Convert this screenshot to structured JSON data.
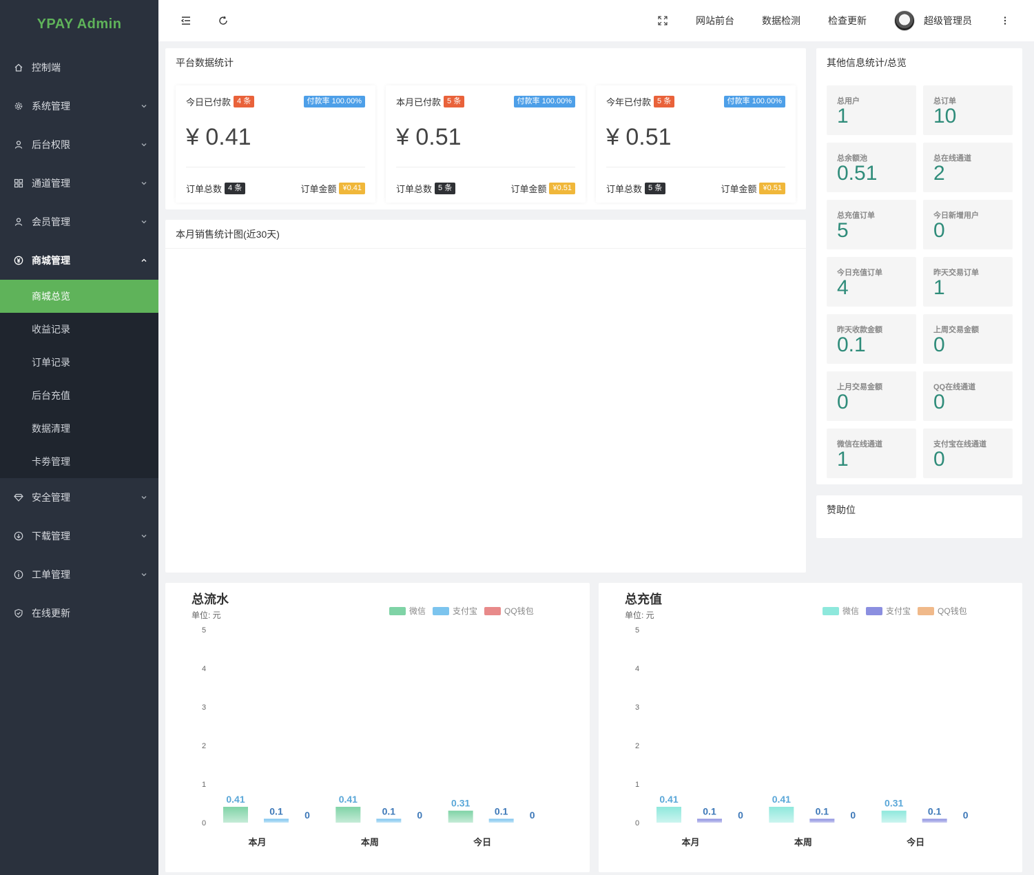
{
  "app": {
    "logo": "YPAY Admin"
  },
  "sidebar": {
    "items": [
      {
        "label": "控制端",
        "icon": "home-icon",
        "expandable": false
      },
      {
        "label": "系统管理",
        "icon": "gear-icon",
        "expandable": true
      },
      {
        "label": "后台权限",
        "icon": "user-icon",
        "expandable": true
      },
      {
        "label": "通道管理",
        "icon": "grid-icon",
        "expandable": true
      },
      {
        "label": "会员管理",
        "icon": "user-icon",
        "expandable": true
      },
      {
        "label": "商城管理",
        "icon": "yen-icon",
        "expandable": true,
        "open": true
      },
      {
        "label": "安全管理",
        "icon": "diamond-icon",
        "expandable": true
      },
      {
        "label": "下载管理",
        "icon": "download-icon",
        "expandable": true
      },
      {
        "label": "工单管理",
        "icon": "info-icon",
        "expandable": true
      },
      {
        "label": "在线更新",
        "icon": "shield-check-icon",
        "expandable": false
      }
    ],
    "submenu": [
      "商城总览",
      "收益记录",
      "订单记录",
      "后台充值",
      "数据清理",
      "卡劵管理"
    ],
    "active_sub": "商城总览"
  },
  "header": {
    "links": [
      "网站前台",
      "数据检测",
      "检查更新"
    ],
    "user": "超级管理员"
  },
  "platform_stats": {
    "title": "平台数据统计",
    "cards": [
      {
        "label": "今日已付款",
        "count": "4 条",
        "rate": "付款率 100.00%",
        "amount": "¥ 0.41",
        "total_label": "订单总数",
        "total": "4 条",
        "money_label": "订单金额",
        "money": "¥0.41"
      },
      {
        "label": "本月已付款",
        "count": "5 条",
        "rate": "付款率 100.00%",
        "amount": "¥ 0.51",
        "total_label": "订单总数",
        "total": "5 条",
        "money_label": "订单金额",
        "money": "¥0.51"
      },
      {
        "label": "今年已付款",
        "count": "5 条",
        "rate": "付款率 100.00%",
        "amount": "¥ 0.51",
        "total_label": "订单总数",
        "total": "5 条",
        "money_label": "订单金额",
        "money": "¥0.51"
      }
    ]
  },
  "sales_chart": {
    "title": "本月销售统计图(近30天)"
  },
  "other_stats": {
    "title": "其他信息统计/总览",
    "tiles": [
      {
        "label": "总用户",
        "value": "1"
      },
      {
        "label": "总订单",
        "value": "10"
      },
      {
        "label": "总余额池",
        "value": "0.51"
      },
      {
        "label": "总在线通道",
        "value": "2"
      },
      {
        "label": "总充值订单",
        "value": "5"
      },
      {
        "label": "今日新增用户",
        "value": "0"
      },
      {
        "label": "今日充值订单",
        "value": "4"
      },
      {
        "label": "昨天交易订单",
        "value": "1"
      },
      {
        "label": "昨天收款金额",
        "value": "0.1"
      },
      {
        "label": "上周交易金额",
        "value": "0"
      },
      {
        "label": "上月交易金额",
        "value": "0"
      },
      {
        "label": "QQ在线通道",
        "value": "0"
      },
      {
        "label": "微信在线通道",
        "value": "1"
      },
      {
        "label": "支付宝在线通道",
        "value": "0"
      }
    ]
  },
  "sponsor": {
    "title": "赞助位"
  },
  "chart_data": [
    {
      "type": "bar",
      "title": "总流水",
      "subtitle": "单位: 元",
      "categories": [
        "本月",
        "本周",
        "今日"
      ],
      "series": [
        {
          "name": "微信",
          "values": [
            0.41,
            0.41,
            0.31
          ],
          "color": "#7fd3a6"
        },
        {
          "name": "支付宝",
          "values": [
            0.1,
            0.1,
            0.1
          ],
          "color": "#7cc4ee"
        },
        {
          "name": "QQ钱包",
          "values": [
            0,
            0,
            0
          ],
          "color": "#e88a8a"
        }
      ],
      "ylim": [
        0,
        5
      ],
      "yticks": [
        0,
        1,
        2,
        3,
        4,
        5
      ],
      "legend": "top-right",
      "label_colors": [
        "#5aa7d8",
        "#3d78b8",
        "#3d78b8"
      ]
    },
    {
      "type": "bar",
      "title": "总充值",
      "subtitle": "单位: 元",
      "categories": [
        "本月",
        "本周",
        "今日"
      ],
      "series": [
        {
          "name": "微信",
          "values": [
            0.41,
            0.41,
            0.31
          ],
          "color": "#8ee8dc"
        },
        {
          "name": "支付宝",
          "values": [
            0.1,
            0.1,
            0.1
          ],
          "color": "#8b8fe0"
        },
        {
          "name": "QQ钱包",
          "values": [
            0,
            0,
            0
          ],
          "color": "#f0b98a"
        }
      ],
      "ylim": [
        0,
        5
      ],
      "yticks": [
        0,
        1,
        2,
        3,
        4,
        5
      ],
      "legend": "top-right",
      "label_colors": [
        "#5aa7d8",
        "#3d78b8",
        "#3d78b8"
      ]
    }
  ]
}
